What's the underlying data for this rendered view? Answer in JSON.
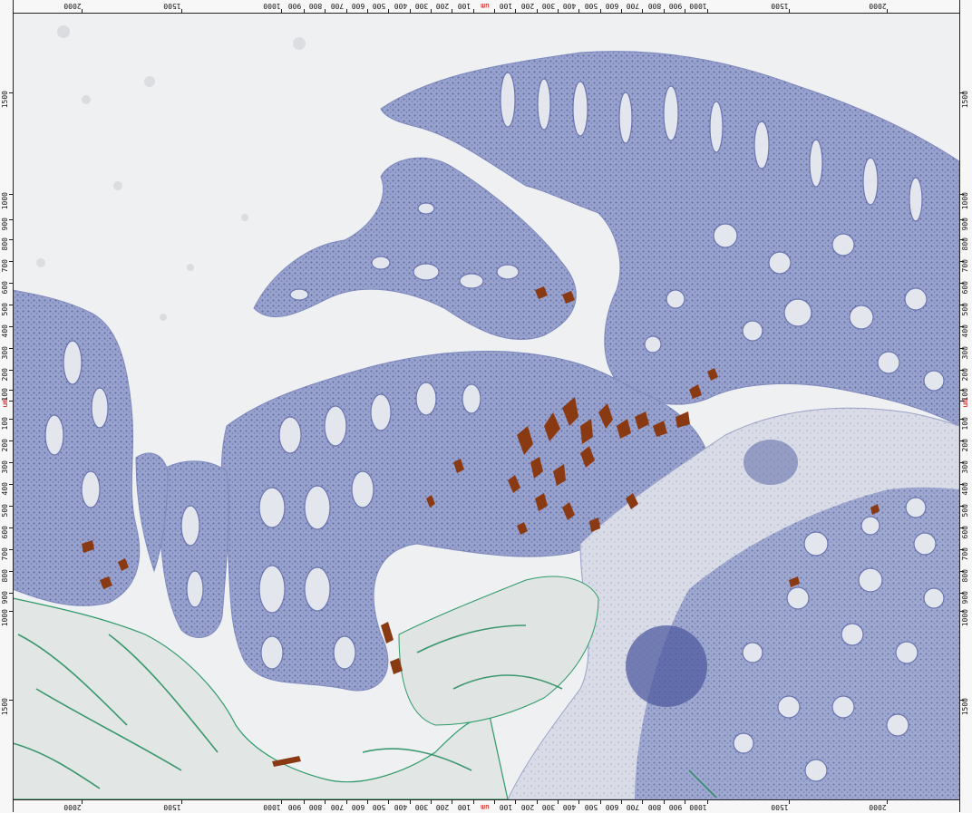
{
  "viewer": {
    "unit": "um",
    "colors": {
      "background": "#eef0f2",
      "tissue_hematoxylin": "#8f9bc8",
      "gland_lumen": "#e6e8ef",
      "dab_stain": "#8a3a12",
      "ink_green": "#1f8a5a",
      "ruler_bg": "#f7f7f7",
      "center_marker": "#cc0000"
    },
    "top_ruler": [
      "2000",
      "1500",
      "1000",
      "900",
      "800",
      "700",
      "600",
      "500",
      "400",
      "300",
      "200",
      "100",
      "um",
      "100",
      "200",
      "300",
      "400",
      "500",
      "600",
      "700",
      "800",
      "900",
      "1000",
      "1500",
      "2000"
    ],
    "bottom_ruler": [
      "2000",
      "1500",
      "1000",
      "900",
      "800",
      "700",
      "600",
      "500",
      "400",
      "300",
      "200",
      "100",
      "um",
      "100",
      "200",
      "300",
      "400",
      "500",
      "600",
      "700",
      "800",
      "900",
      "1000",
      "1500",
      "2000"
    ],
    "left_ruler": [
      "1500",
      "1000",
      "900",
      "800",
      "700",
      "600",
      "500",
      "400",
      "300",
      "200",
      "100",
      "um",
      "100",
      "200",
      "300",
      "400",
      "500",
      "600",
      "700",
      "800",
      "900",
      "1000",
      "1500"
    ],
    "right_ruler": [
      "1500",
      "1000",
      "900",
      "800",
      "700",
      "600",
      "500",
      "400",
      "300",
      "200",
      "100",
      "um",
      "100",
      "200",
      "300",
      "400",
      "500",
      "600",
      "700",
      "800",
      "900",
      "1000",
      "1500"
    ]
  }
}
